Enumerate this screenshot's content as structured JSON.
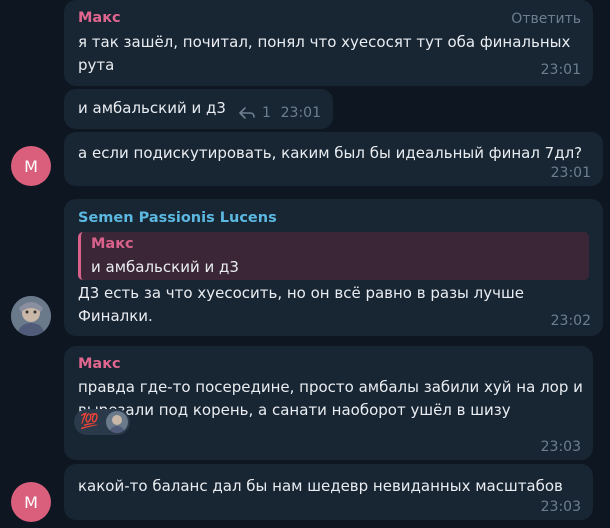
{
  "colors": {
    "background": "#0e1621",
    "bubble": "#182533",
    "maks_name": "#e0668f",
    "semen_name": "#5bb8e0",
    "time": "#6d7f8f",
    "avatar_m": "#d95f7c"
  },
  "messages": [
    {
      "sender": "Макс",
      "action": "Ответить",
      "lines": [
        "я так зашёл, почитал, понял что хуесосят тут оба финальных",
        "рута"
      ],
      "time": "23:01"
    },
    {
      "text": "и амбальский и д3",
      "reply_count": "1",
      "time": "23:01"
    },
    {
      "text": "а если подискутировать, каким был бы идеальный финал 7дл?",
      "time": "23:01",
      "avatar_letter": "M"
    },
    {
      "sender": "Semen Passionis Lucens",
      "quote_sender": "Макс",
      "quote_text": "и амбальский и д3",
      "lines": [
        "Д3 есть за что хуесосить, но он всё равно в разы лучше",
        "Финалки."
      ],
      "time": "23:02"
    },
    {
      "sender": "Макс",
      "lines": [
        "правда где-то посередине, просто амбалы забили хуй на лор и",
        "вырезали под корень, а санати наоборот ушёл в шизу"
      ],
      "reaction_emoji": "💯",
      "time": "23:03"
    },
    {
      "text": "какой-то баланс дал бы нам шедевр невиданных масштабов",
      "time": "23:03",
      "avatar_letter": "M"
    }
  ]
}
